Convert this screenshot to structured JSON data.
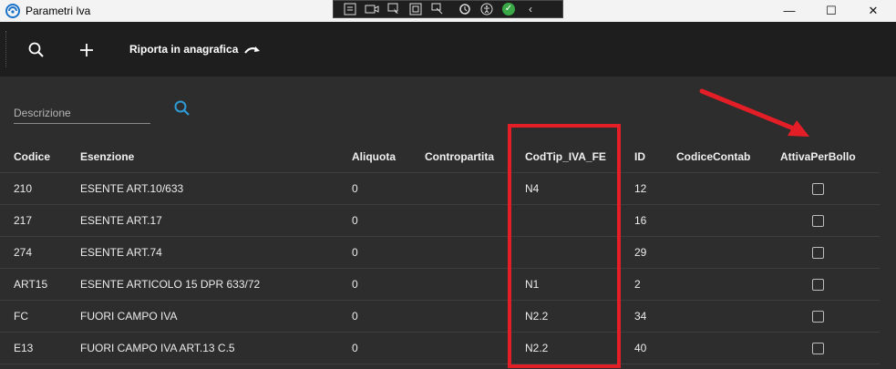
{
  "window": {
    "title": "Parametri Iva",
    "controls": {
      "minimize": "—",
      "maximize": "☐",
      "close": "✕"
    }
  },
  "debug_toolbar": {
    "icons": [
      "live-tree-icon",
      "video-icon",
      "select-element-icon",
      "display-layout-icon",
      "track-focus-icon",
      "hot-reload-icon",
      "accessibility-icon",
      "ok-status-icon",
      "collapse-icon"
    ]
  },
  "toolbar": {
    "search_icon": "search-icon",
    "add_icon": "plus-icon",
    "action_label": "Riporta in anagrafica"
  },
  "search": {
    "placeholder": "Descrizione",
    "value": ""
  },
  "grid": {
    "headers": {
      "codice": "Codice",
      "esenzione": "Esenzione",
      "aliquota": "Aliquota",
      "contropartita": "Contropartita",
      "codtip": "CodTip_IVA_FE",
      "id": "ID",
      "contab": "CodiceContab",
      "bollo": "AttivaPerBollo"
    },
    "rows": [
      {
        "codice": "210",
        "esenzione": "ESENTE ART.10/633",
        "aliquota": "0",
        "contropartita": "",
        "codtip": "N4",
        "id": "12",
        "contab": "",
        "bollo": false
      },
      {
        "codice": "217",
        "esenzione": "ESENTE ART.17",
        "aliquota": "0",
        "contropartita": "",
        "codtip": "",
        "id": "16",
        "contab": "",
        "bollo": false
      },
      {
        "codice": "274",
        "esenzione": "ESENTE ART.74",
        "aliquota": "0",
        "contropartita": "",
        "codtip": "",
        "id": "29",
        "contab": "",
        "bollo": false
      },
      {
        "codice": "ART15",
        "esenzione": "ESENTE ARTICOLO 15 DPR 633/72",
        "aliquota": "0",
        "contropartita": "",
        "codtip": "N1",
        "id": "2",
        "contab": "",
        "bollo": false
      },
      {
        "codice": "FC",
        "esenzione": "FUORI CAMPO IVA",
        "aliquota": "0",
        "contropartita": "",
        "codtip": "N2.2",
        "id": "34",
        "contab": "",
        "bollo": false
      },
      {
        "codice": "E13",
        "esenzione": "FUORI CAMPO IVA ART.13 C.5",
        "aliquota": "0",
        "contropartita": "",
        "codtip": "N2.2",
        "id": "40",
        "contab": "",
        "bollo": false
      }
    ]
  },
  "colors": {
    "accent": "#2e9bd6",
    "annotation": "#e41e26",
    "background": "#2d2d2d",
    "toolbar": "#1e1e1e"
  }
}
